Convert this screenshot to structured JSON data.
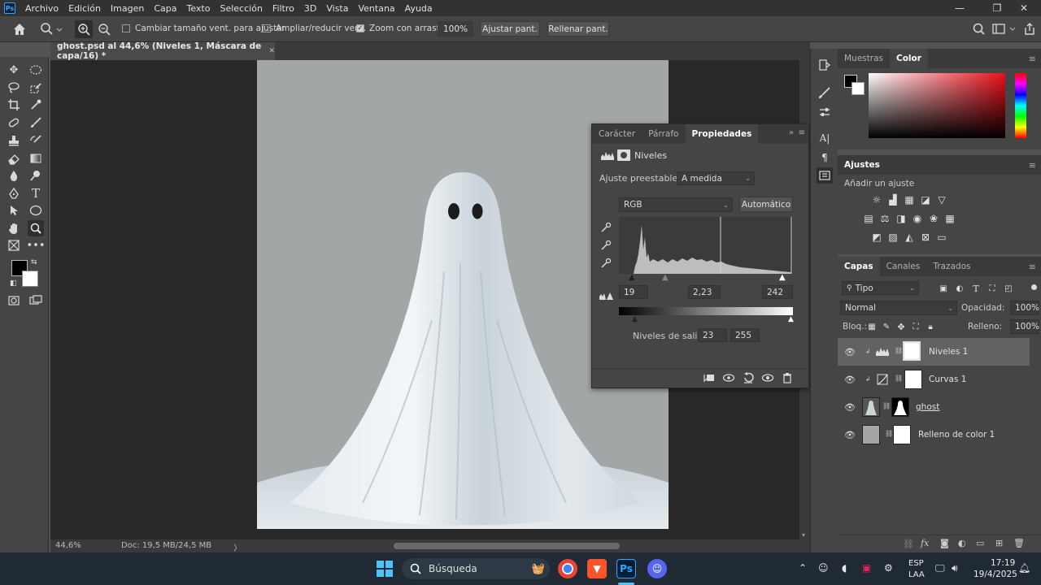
{
  "app": {
    "logo_text": "Ps",
    "menu": [
      "Archivo",
      "Edición",
      "Imagen",
      "Capa",
      "Texto",
      "Selección",
      "Filtro",
      "3D",
      "Vista",
      "Ventana",
      "Ayuda"
    ],
    "window_controls": [
      "—",
      "❐",
      "✕"
    ]
  },
  "options": {
    "resize_windows": "Cambiar tamaño vent. para ajustar",
    "zoom_all": "Ampliar/reducir vent.",
    "scrubby_zoom": "Zoom con arrastre",
    "zoom_value": "100%",
    "fit_screen": "Ajustar pant.",
    "fill_screen": "Rellenar pant."
  },
  "document": {
    "tab_title": "ghost.psd al 44,6% (Niveles 1, Máscara de capa/16) *",
    "close": "✕",
    "zoom": "44,6%",
    "doc_size": "Doc: 19,5 MB/24,5 MB",
    "status_arrow": "〉"
  },
  "properties": {
    "tabs": [
      "Carácter",
      "Párrafo",
      "Propiedades"
    ],
    "title": "Niveles",
    "preset_label": "Ajuste preestablecido:",
    "preset_value": "A medida",
    "channel": "RGB",
    "auto": "Automático",
    "input_black": "19",
    "input_gamma": "2,23",
    "input_white": "242",
    "output_label": "Niveles de salida:",
    "output_black": "23",
    "output_white": "255"
  },
  "color_panel": {
    "tabs": [
      "Muestras",
      "Color"
    ],
    "foreground": "#000000",
    "background": "#ffffff",
    "hue_base": "#e8101a"
  },
  "adjustments": {
    "title": "Ajustes",
    "subtitle": "Añadir un ajuste"
  },
  "layers": {
    "tabs": [
      "Capas",
      "Canales",
      "Trazados"
    ],
    "filter": "Tipo",
    "blend_mode": "Normal",
    "opacity_label": "Opacidad:",
    "opacity": "100%",
    "lock_label": "Bloq.:",
    "fill_label": "Relleno:",
    "fill": "100%",
    "items": [
      {
        "name": "Niveles 1",
        "selected": true
      },
      {
        "name": "Curvas 1",
        "selected": false
      },
      {
        "name": "ghost",
        "selected": false
      },
      {
        "name": "Relleno de color 1",
        "selected": false
      }
    ]
  },
  "taskbar": {
    "search": "Búsqueda",
    "lang_1": "ESP",
    "lang_2": "LAA",
    "time": "17:19",
    "date": "19/4/2025",
    "ps_label": "Ps"
  }
}
